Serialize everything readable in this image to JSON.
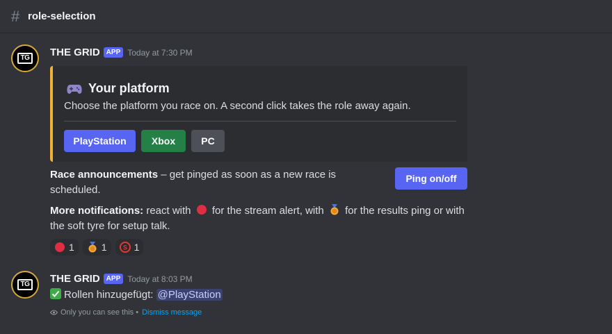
{
  "channel": {
    "name": "role-selection"
  },
  "messages": [
    {
      "author": "THE GRID",
      "badge": "APP",
      "timestamp": "Today at 7:30 PM",
      "avatar_text": "TG",
      "embed": {
        "accent_color": "#f0b232",
        "title": "Your platform",
        "title_icon": "gamepad-icon",
        "description": "Choose the platform you race on. A second click takes the role away again.",
        "buttons": [
          {
            "label": "PlayStation",
            "style": "primary",
            "color": "#5865f2"
          },
          {
            "label": "Xbox",
            "style": "success",
            "color": "#248046"
          },
          {
            "label": "PC",
            "style": "secondary",
            "color": "#4e5058"
          }
        ]
      },
      "race_announcements": {
        "bold": "Race announcements",
        "text": " – get pinged as soon as a new race is scheduled.",
        "button_label": "Ping on/off"
      },
      "notifications": {
        "bold": "More notifications:",
        "part1": " react with ",
        "part2": " for the stream alert, with ",
        "part3": " for the results ping or with the soft tyre for setup talk."
      },
      "reactions": [
        {
          "icon": "red-circle-icon",
          "count": "1"
        },
        {
          "icon": "medal-icon",
          "count": "1"
        },
        {
          "icon": "soft-tyre-icon",
          "count": "1"
        }
      ]
    },
    {
      "author": "THE GRID",
      "badge": "APP",
      "timestamp": "Today at 8:03 PM",
      "avatar_text": "TG",
      "content": "Rollen hinzugefügt: ",
      "mention": "@PlayStation",
      "ephemeral_note": "Only you can see this •",
      "dismiss_label": "Dismiss message"
    }
  ],
  "colors": {
    "background": "#313338",
    "blurple": "#5865f2",
    "link": "#00a8fc"
  }
}
